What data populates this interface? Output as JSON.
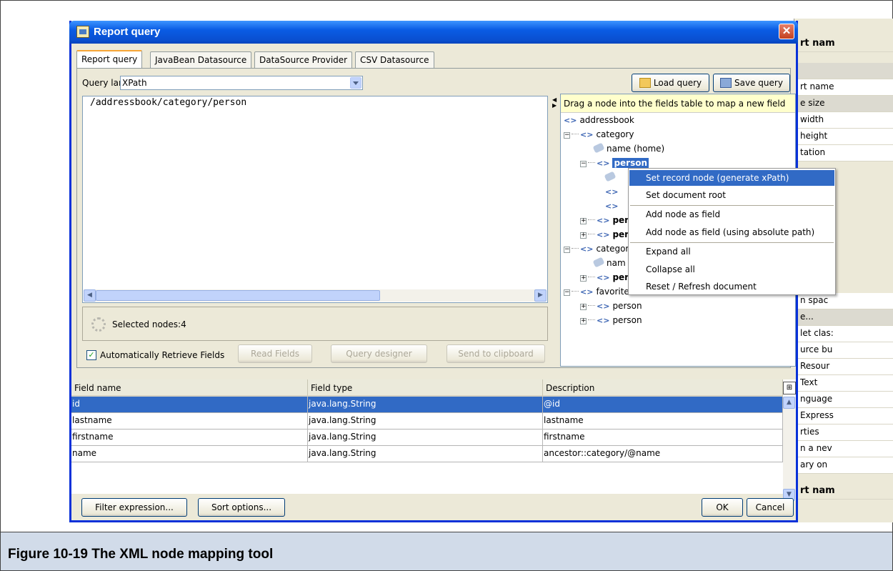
{
  "figure": {
    "caption": "Figure 10-19  The XML node mapping tool"
  },
  "background_panel": {
    "rows": [
      "rt nam",
      "",
      "rt name",
      "e size",
      "width",
      "height",
      "tation",
      "",
      "",
      "",
      "",
      "",
      "",
      "n spac",
      "e...",
      "let clas:",
      "urce bu",
      "Resour",
      "Text",
      "nguage",
      "Express",
      "rties",
      "n a nev",
      "ary on",
      "",
      "rt nam"
    ]
  },
  "dialog": {
    "title": "Report query",
    "close_glyph": "✕",
    "tabs": [
      {
        "label": "Report query",
        "active": true
      },
      {
        "label": "JavaBean Datasource",
        "active": false
      },
      {
        "label": "DataSource Provider",
        "active": false
      },
      {
        "label": "CSV Datasource",
        "active": false
      }
    ],
    "query_language_label": "Query language",
    "query_language_value": "XPath",
    "load_query_label": "Load query",
    "save_query_label": "Save query",
    "query_text": "/addressbook/category/person",
    "selected_nodes": "Selected nodes:4",
    "auto_retrieve_label": "Automatically Retrieve Fields",
    "auto_retrieve_checked": true,
    "read_fields_label": "Read Fields",
    "query_designer_label": "Query designer",
    "send_to_clipboard_label": "Send to clipboard",
    "tree": {
      "hint": "Drag a node into the fields table to map a new field",
      "nodes": [
        {
          "label": "addressbook"
        },
        {
          "label": "category"
        },
        {
          "label": "name (home)"
        },
        {
          "label": "person"
        },
        {
          "label": ""
        },
        {
          "label": ""
        },
        {
          "label": ""
        },
        {
          "label": "per"
        },
        {
          "label": "per"
        },
        {
          "label": "category"
        },
        {
          "label": "nam"
        },
        {
          "label": "per"
        },
        {
          "label": "favorites"
        },
        {
          "label": "person"
        },
        {
          "label": "person"
        }
      ]
    },
    "context_menu": {
      "items": [
        "Set record node (generate xPath)",
        "Set document root",
        "Add node as field",
        "Add node as field (using absolute path)",
        "Expand all",
        "Collapse all",
        "Reset / Refresh document"
      ]
    },
    "table": {
      "columns": [
        "Field name",
        "Field type",
        "Description"
      ],
      "rows": [
        [
          "id",
          "java.lang.String",
          "@id"
        ],
        [
          "lastname",
          "java.lang.String",
          "lastname"
        ],
        [
          "firstname",
          "java.lang.String",
          "firstname"
        ],
        [
          "name",
          "java.lang.String",
          "ancestor::category/@name"
        ]
      ]
    },
    "filter_expression_label": "Filter expression...",
    "sort_options_label": "Sort options...",
    "ok_label": "OK",
    "cancel_label": "Cancel",
    "colors": {
      "selection": "#316ac5",
      "titlebar": "#0a5ce4",
      "hint_bg": "#ffffcc"
    }
  }
}
